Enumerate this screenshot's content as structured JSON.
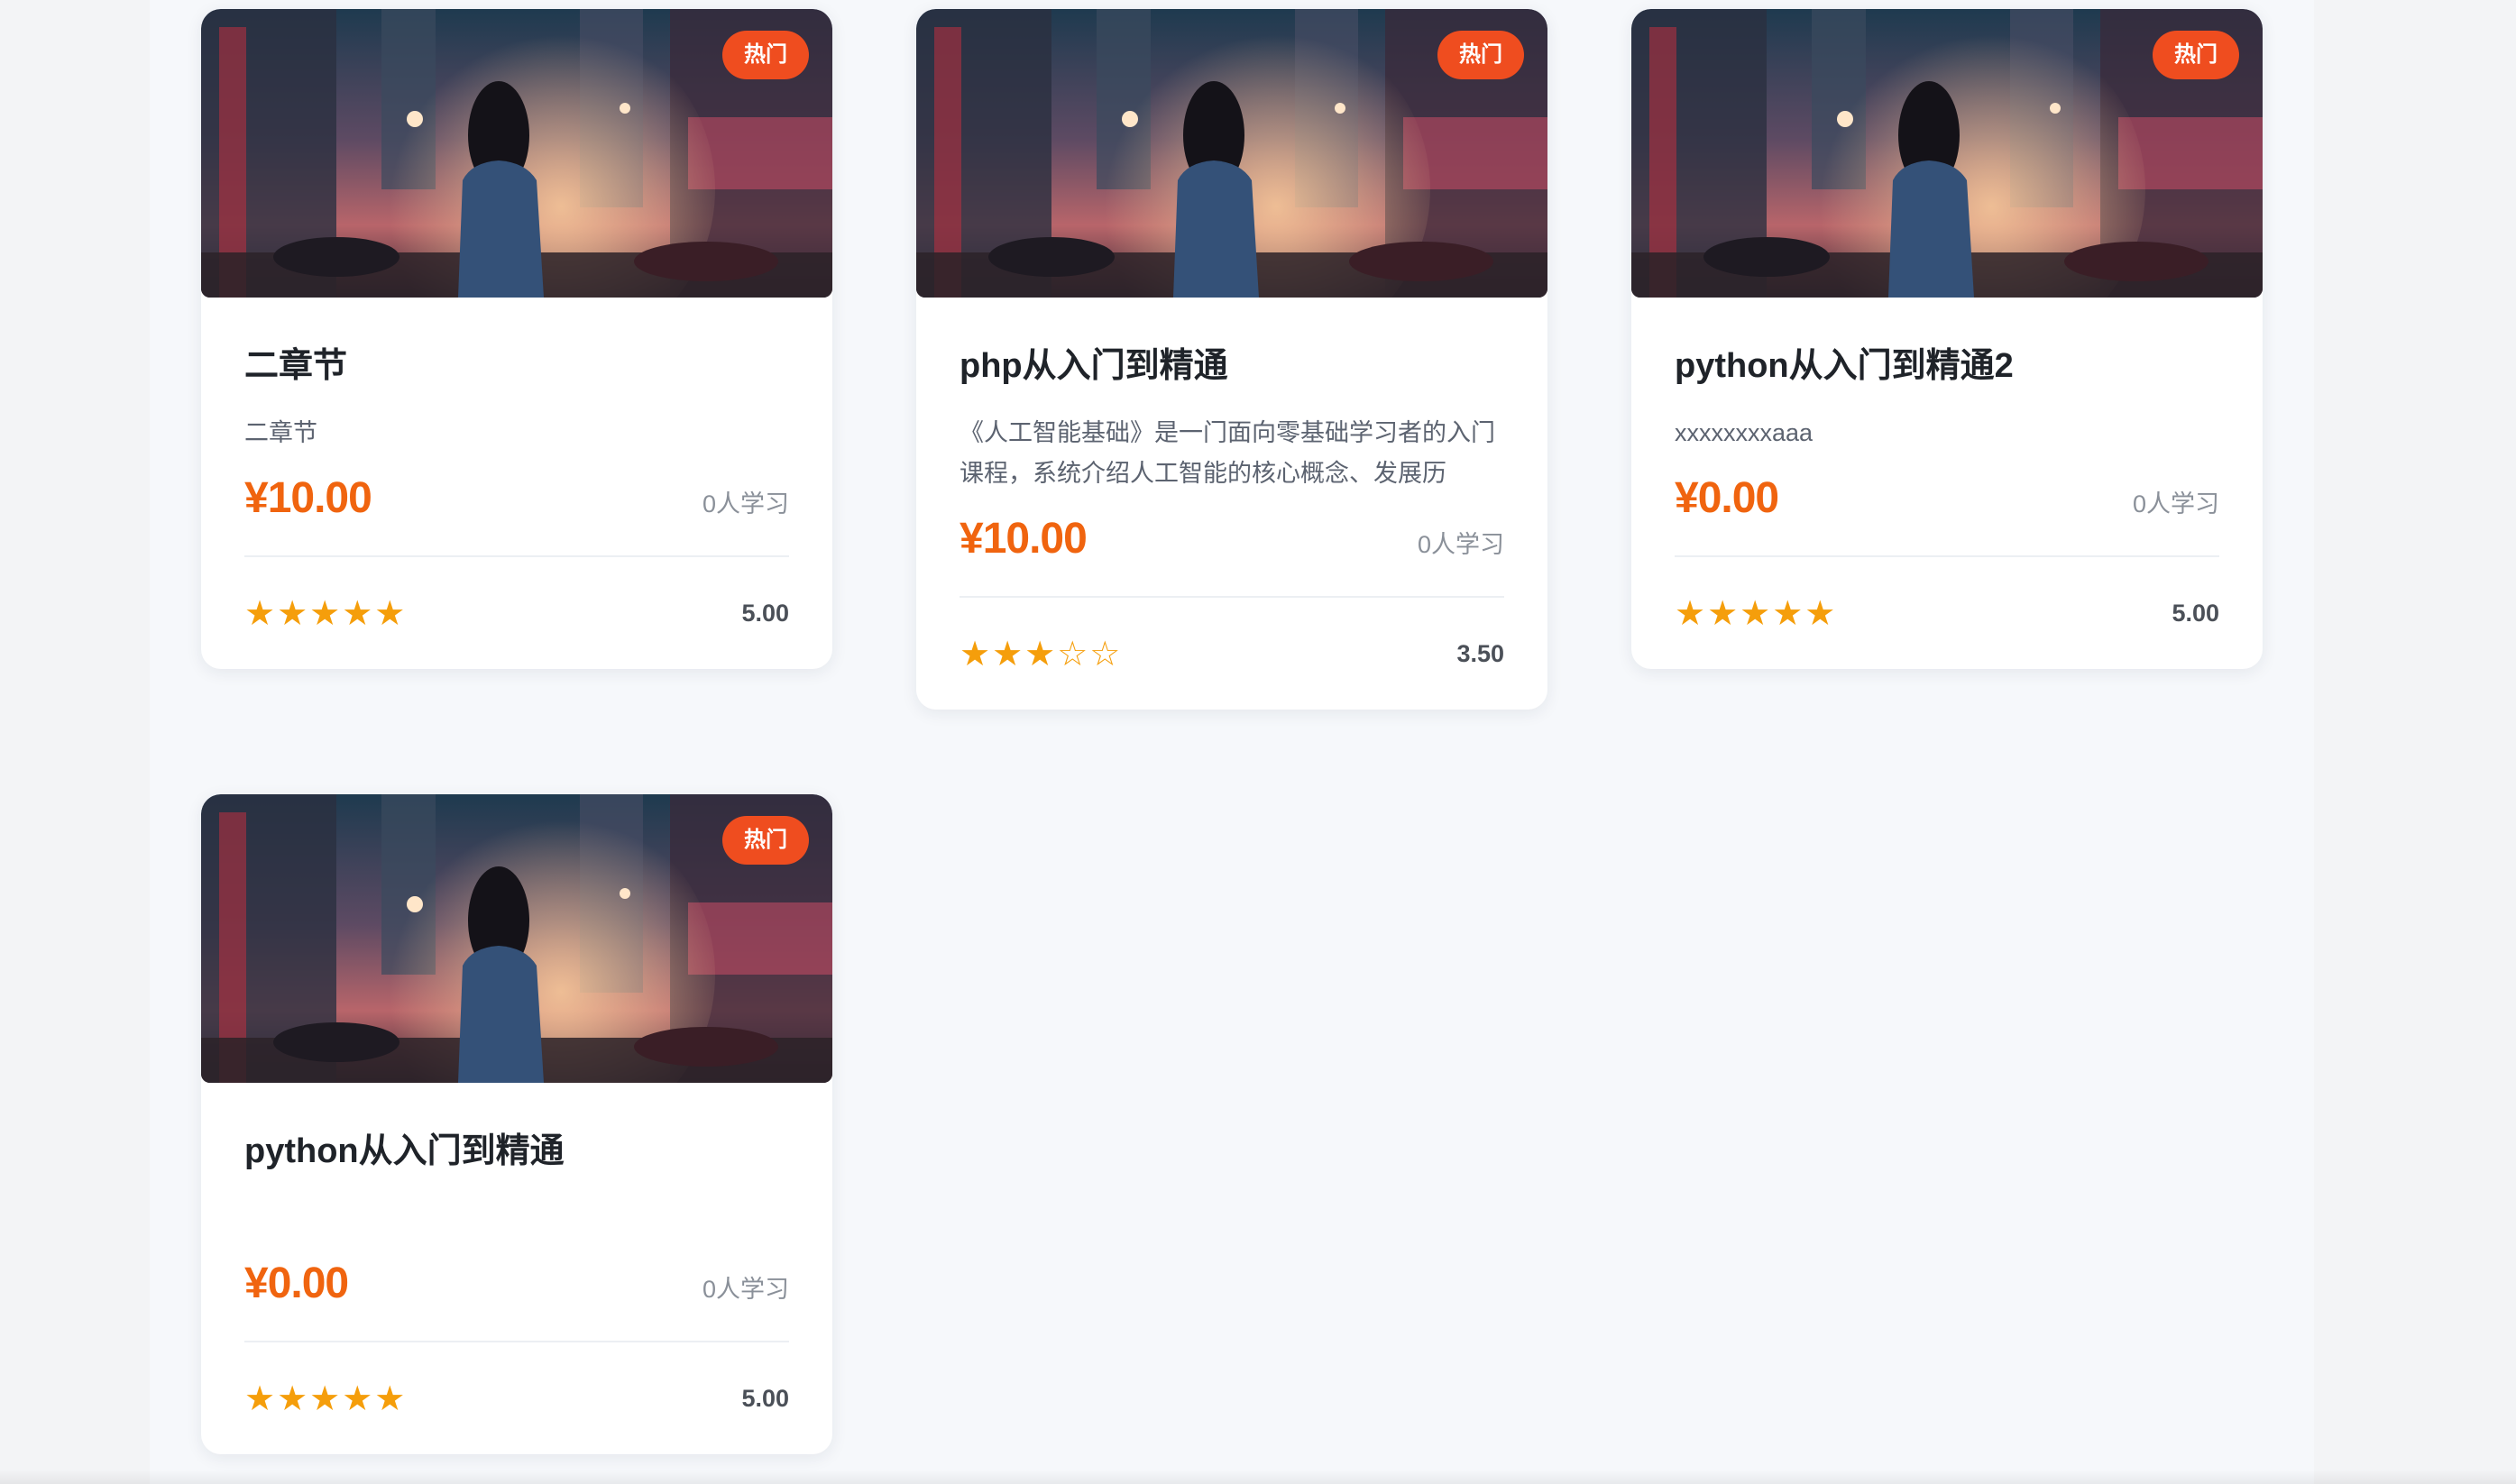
{
  "courses": [
    {
      "badge": "热门",
      "title": "二章节",
      "desc": "二章节",
      "price": "¥10.00",
      "students": "0人学习",
      "stars": "★★★★★",
      "rating": "5.00"
    },
    {
      "badge": "热门",
      "title": "php从入门到精通",
      "desc": "《人工智能基础》是一门面向零基础学习者的入门课程，系统介绍人工智能的核心概念、发展历",
      "price": "¥10.00",
      "students": "0人学习",
      "stars": "★★★☆☆",
      "rating": "3.50"
    },
    {
      "badge": "热门",
      "title": "python从入门到精通2",
      "desc": "xxxxxxxxaaa",
      "price": "¥0.00",
      "students": "0人学习",
      "stars": "★★★★★",
      "rating": "5.00"
    },
    {
      "badge": "热门",
      "title": "python从入门到精通",
      "desc": "",
      "price": "¥0.00",
      "students": "0人学习",
      "stars": "★★★★★",
      "rating": "5.00"
    }
  ],
  "colors": {
    "accent_price": "#f0640f",
    "badge_bg": "#ef4d1f",
    "star": "#f59e0b"
  },
  "icons": {
    "thumbnail": "night-city-street-image",
    "rating": "star-icon"
  }
}
